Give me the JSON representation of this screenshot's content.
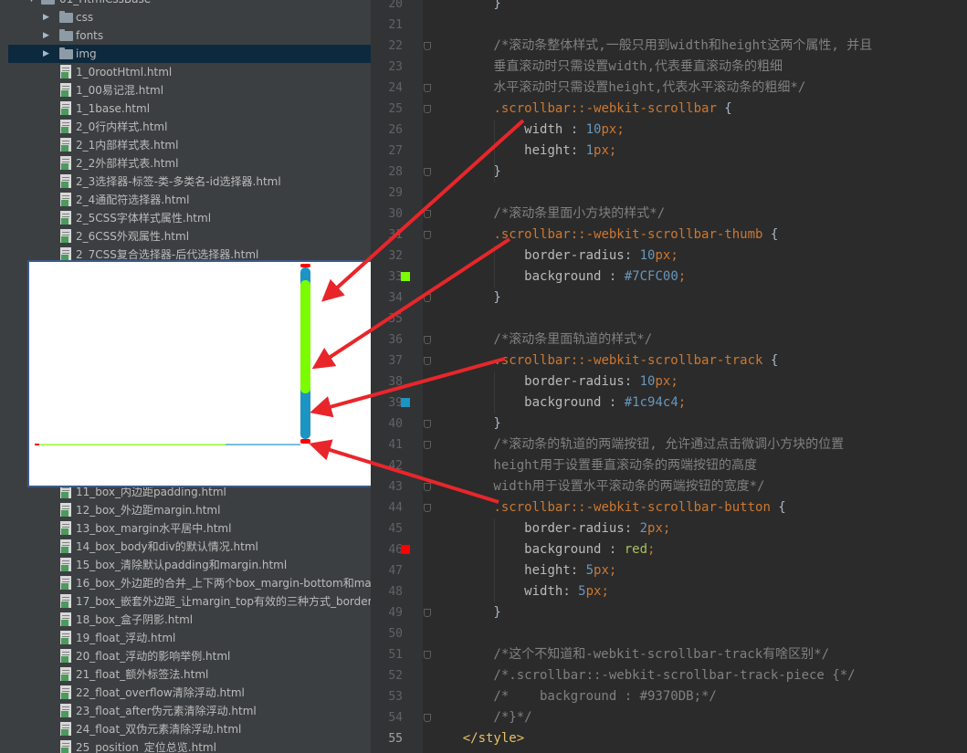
{
  "project_tree": {
    "top_partial": "01_HtmlCssBase",
    "folders": [
      {
        "label": "css"
      },
      {
        "label": "fonts"
      },
      {
        "label": "img"
      }
    ],
    "files_top": [
      "1_0rootHtml.html",
      "1_00易记混.html",
      "1_1base.html",
      "2_0行内样式.html",
      "2_1内部样式表.html",
      "2_2外部样式表.html",
      "2_3选择器-标签-类-多类名-id选择器.html",
      "2_4通配符选择器.html",
      "2_5CSS字体样式属性.html",
      "2_6CSS外观属性.html",
      "2_7CSS复合选择器-后代选择器.html"
    ],
    "files_bottom": [
      "11_box_内边距padding.html",
      "12_box_外边距margin.html",
      "13_box_margin水平居中.html",
      "14_box_body和div的默认情况.html",
      "15_box_清除默认padding和margin.html",
      "16_box_外边距的合并_上下两个box_margin-bottom和mar",
      "17_box_嵌套外边距_让margin_top有效的三种方式_border-",
      "18_box_盒子阴影.html",
      "19_float_浮动.html",
      "20_float_浮动的影响举例.html",
      "21_float_额外标签法.html",
      "22_float_overflow清除浮动.html",
      "23_float_after伪元素清除浮动.html",
      "24_float_双伪元素清除浮动.html",
      "25_position_定位总览.html"
    ]
  },
  "scrollbar_demo": {
    "track_color": "#1c94c4",
    "thumb_color": "#7CFC00",
    "button_color": "red"
  },
  "editor": {
    "lines": [
      {
        "n": "20",
        "code": "        }"
      },
      {
        "n": "21",
        "code": ""
      },
      {
        "n": "22",
        "code": "        /*滚动条整体样式,一般只用到width和height这两个属性, 并且"
      },
      {
        "n": "23",
        "code": "        垂直滚动时只需设置width,代表垂直滚动条的粗细"
      },
      {
        "n": "24",
        "code": "        水平滚动时只需设置height,代表水平滚动条的粗细*/"
      },
      {
        "n": "25",
        "code": "        .scrollbar::-webkit-scrollbar {"
      },
      {
        "n": "26",
        "code": "            width : 10px;"
      },
      {
        "n": "27",
        "code": "            height: 1px;"
      },
      {
        "n": "28",
        "code": "        }"
      },
      {
        "n": "29",
        "code": ""
      },
      {
        "n": "30",
        "code": "        /*滚动条里面小方块的样式*/"
      },
      {
        "n": "31",
        "code": "        .scrollbar::-webkit-scrollbar-thumb {"
      },
      {
        "n": "32",
        "code": "            border-radius: 10px;"
      },
      {
        "n": "33",
        "code": "            background : #7CFC00;"
      },
      {
        "n": "34",
        "code": "        }"
      },
      {
        "n": "35",
        "code": ""
      },
      {
        "n": "36",
        "code": "        /*滚动条里面轨道的样式*/"
      },
      {
        "n": "37",
        "code": "        .scrollbar::-webkit-scrollbar-track {"
      },
      {
        "n": "38",
        "code": "            border-radius: 10px;"
      },
      {
        "n": "39",
        "code": "            background : #1c94c4;"
      },
      {
        "n": "40",
        "code": "        }"
      },
      {
        "n": "41",
        "code": "        /*滚动条的轨道的两端按钮, 允许通过点击微调小方块的位置"
      },
      {
        "n": "42",
        "code": "        height用于设置垂直滚动条的两端按钮的高度"
      },
      {
        "n": "43",
        "code": "        width用于设置水平滚动条的两端按钮的宽度*/"
      },
      {
        "n": "44",
        "code": "        .scrollbar::-webkit-scrollbar-button {"
      },
      {
        "n": "45",
        "code": "            border-radius: 2px;"
      },
      {
        "n": "46",
        "code": "            background : red;"
      },
      {
        "n": "47",
        "code": "            height: 5px;"
      },
      {
        "n": "48",
        "code": "            width: 5px;"
      },
      {
        "n": "49",
        "code": "        }"
      },
      {
        "n": "50",
        "code": ""
      },
      {
        "n": "51",
        "code": "        /*这个不知道和-webkit-scrollbar-track有啥区别*/"
      },
      {
        "n": "52",
        "code": "        /*.scrollbar::-webkit-scrollbar-track-piece {*/"
      },
      {
        "n": "53",
        "code": "        /*    background : #9370DB;*/"
      },
      {
        "n": "54",
        "code": "        /*}*/"
      },
      {
        "n": "55",
        "code": "    </style>"
      }
    ],
    "swatches": [
      {
        "line": "33",
        "color": "#7CFC00"
      },
      {
        "line": "39",
        "color": "#1c94c4"
      },
      {
        "line": "46",
        "color": "#ff0000"
      }
    ],
    "current_line": "55"
  },
  "annotation_color": "#e8262a"
}
